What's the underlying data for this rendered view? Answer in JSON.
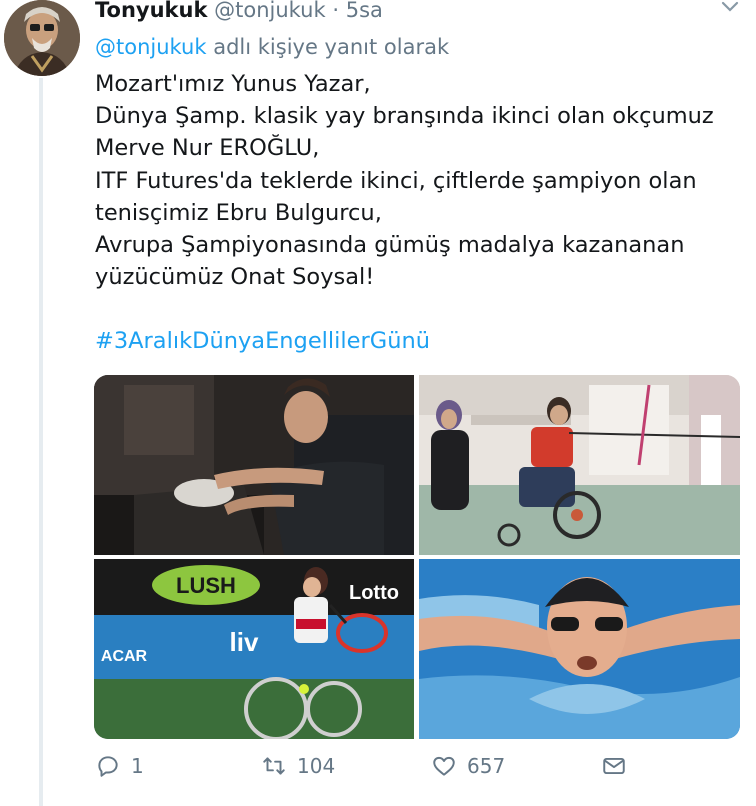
{
  "tweet": {
    "author_name": "Tonyukuk",
    "author_handle": "@tonjukuk",
    "separator": "·",
    "time": "5sa",
    "reply_mention": "@tonjukuk",
    "reply_suffix": "adlı kişiye yanıt olarak",
    "text_lines": [
      "Mozart'ımız Yunus Yazar,",
      "Dünya Şamp. klasik yay branşında ikinci olan okçumuz",
      "Merve Nur EROĞLU,",
      "ITF Futures'da teklerde ikinci, çiftlerde şampiyon olan",
      "tenisçimiz Ebru Bulgurcu,",
      "Avrupa Şampiyonasında gümüş madalya kazananan",
      "yüzücümüz Onat Soysal!"
    ],
    "hashtag": "#3AralıkDünyaEngellilerGünü"
  },
  "photos": {
    "p3_sign_1": "LUSH",
    "p3_sign_2": "Lotto",
    "p3_sign_3": "ACAR",
    "p3_sign_4": "liv"
  },
  "actions": {
    "reply_count": "1",
    "retweet_count": "104",
    "like_count": "657"
  },
  "colors": {
    "link": "#1da1f2",
    "secondary_text": "#657786",
    "thread_line": "#e6ecf0"
  },
  "icons": {
    "reply": "reply-icon",
    "retweet": "retweet-icon",
    "like": "heart-icon",
    "dm": "envelope-icon",
    "menu": "chevron-down-icon"
  }
}
